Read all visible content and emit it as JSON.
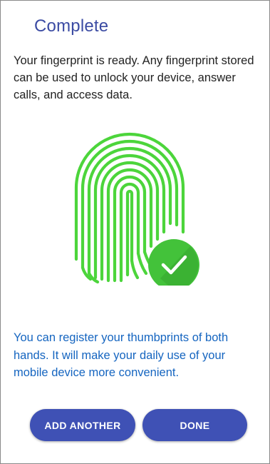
{
  "header": {
    "title": "Complete"
  },
  "content": {
    "description": "Your fingerprint is ready. Any fingerprint stored can be used to unlock your device, answer calls, and access data.",
    "tip": "You can register your thumbprints of both hands. It will make your daily use of your mobile device more convenient."
  },
  "illustration": {
    "fingerprint_icon": "fingerprint-icon",
    "check_icon": "check-circle-icon",
    "fingerprint_color": "#4cd53b",
    "check_color": "#43c23a"
  },
  "actions": {
    "add_another_label": "ADD ANOTHER",
    "done_label": "DONE"
  },
  "colors": {
    "title": "#3b4ba3",
    "tip_text": "#1565c0",
    "button": "#3f51b5"
  }
}
